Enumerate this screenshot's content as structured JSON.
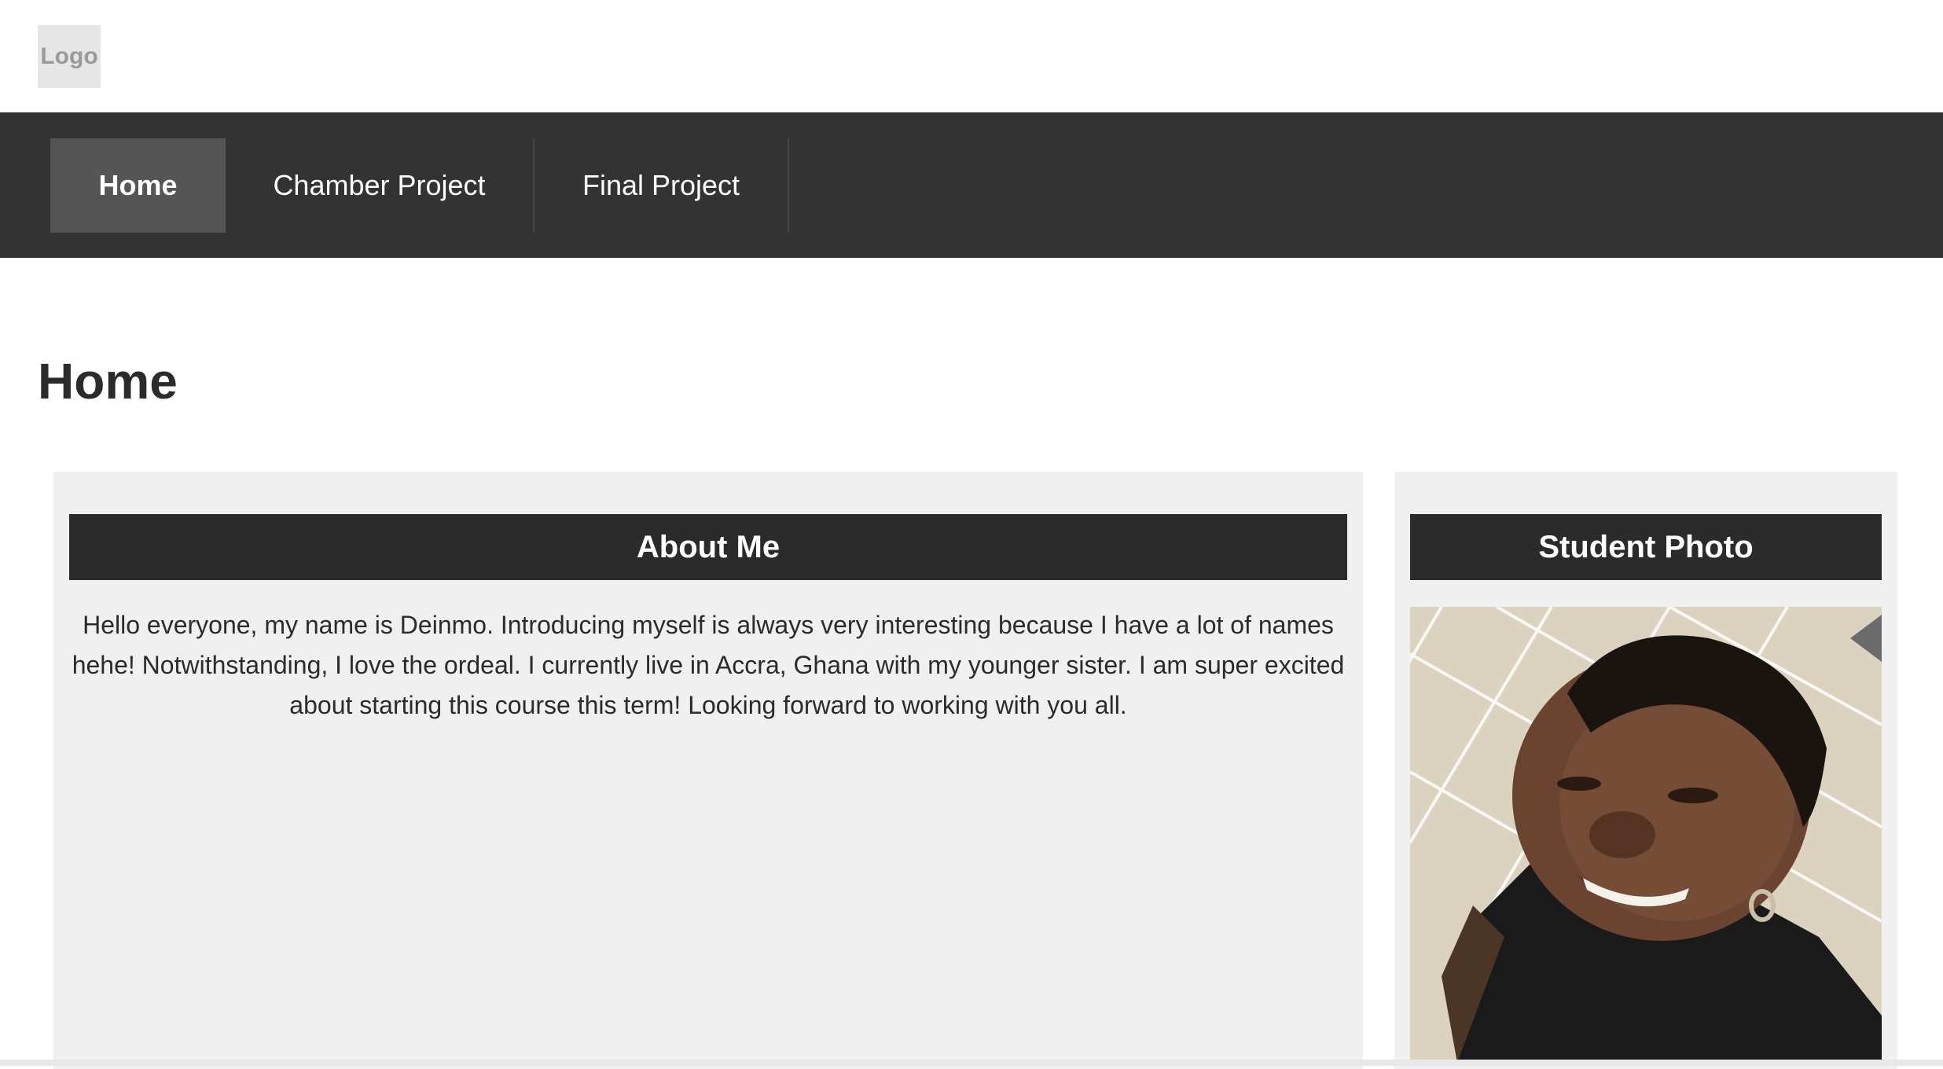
{
  "header": {
    "logo_text": "Logo"
  },
  "nav": {
    "items": [
      {
        "label": "Home",
        "active": true
      },
      {
        "label": "Chamber Project",
        "active": false
      },
      {
        "label": "Final Project",
        "active": false
      }
    ]
  },
  "main": {
    "title": "Home",
    "about": {
      "heading": "About Me",
      "text": "Hello everyone, my name is Deinmo. Introducing myself is always very interesting because I have a lot of names hehe! Notwithstanding, I love the ordeal. I currently live in Accra, Ghana with my younger sister. I am super excited about starting this course this term! Looking forward to working with you all."
    },
    "photo": {
      "heading": "Student Photo"
    }
  },
  "colors": {
    "nav_background": "#333333",
    "nav_active": "#555555",
    "card_background": "#f0f0f0",
    "card_header": "#2b2b2b"
  }
}
